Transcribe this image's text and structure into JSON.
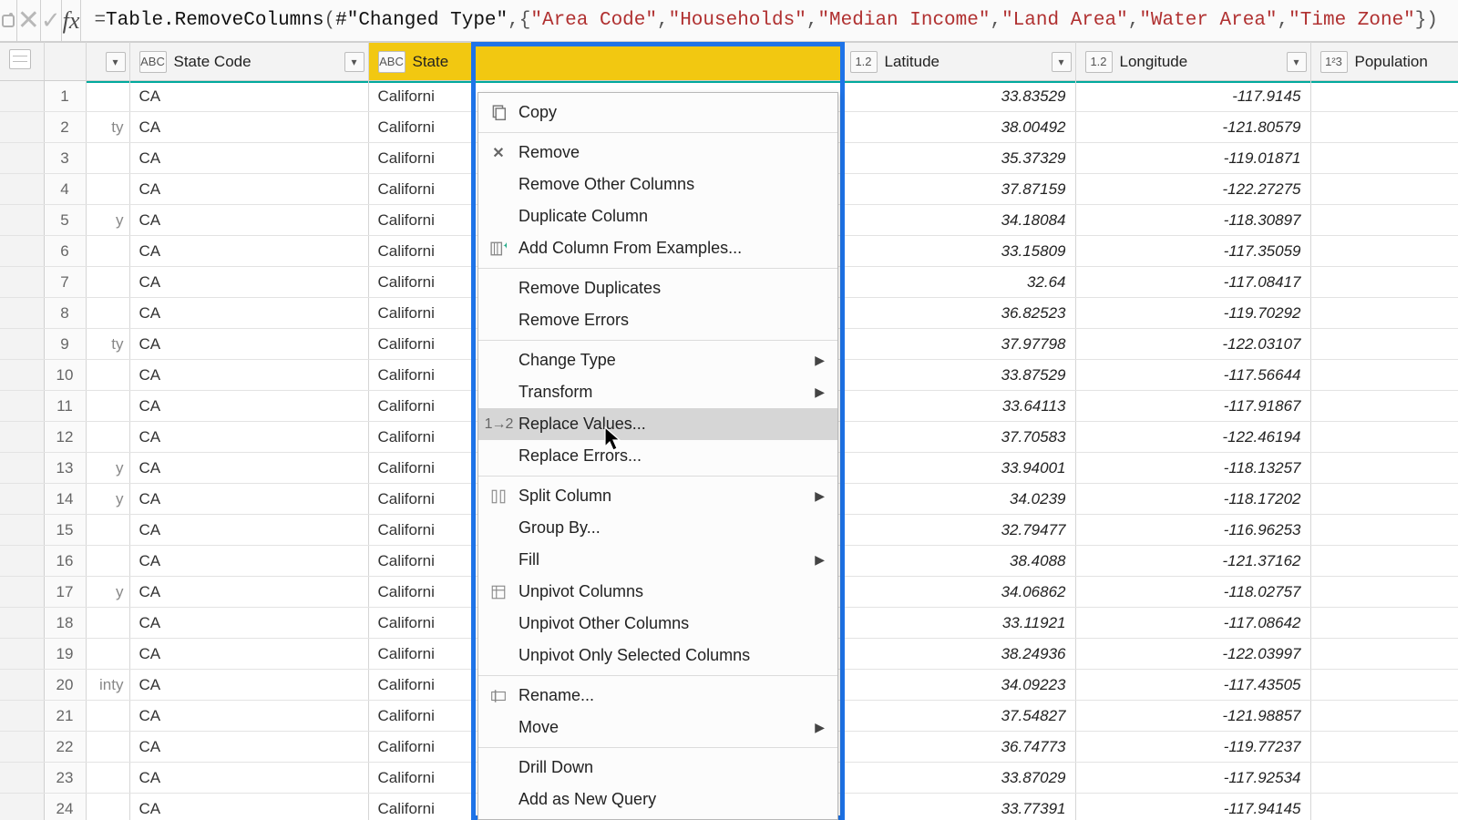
{
  "formula": {
    "prefix": "= ",
    "fn": "Table.RemoveColumns",
    "open": "(",
    "ref": "#\"Changed Type\"",
    "comma": ",",
    "lbrace": "{",
    "cols": [
      "\"Area Code\"",
      "\"Households\"",
      "\"Median Income\"",
      "\"Land Area\"",
      "\"Water Area\"",
      "\"Time Zone\""
    ],
    "sep": ", ",
    "rbrace": "}",
    "close": ")"
  },
  "toolbar": {
    "cancel_glyph": "✕",
    "confirm_glyph": "✓",
    "fx_label": "fx"
  },
  "columns": {
    "state_code": {
      "label": "State Code",
      "type_label": "ABC"
    },
    "state": {
      "label": "State",
      "type_label": "ABC"
    },
    "latitude": {
      "label": "Latitude",
      "type_label": "1.2"
    },
    "longitude": {
      "label": "Longitude",
      "type_label": "1.2"
    },
    "population": {
      "label": "Population",
      "type_label": "1²3"
    }
  },
  "menu": {
    "copy": "Copy",
    "remove": "Remove",
    "remove_other": "Remove Other Columns",
    "duplicate": "Duplicate Column",
    "add_from_examples": "Add Column From Examples...",
    "remove_duplicates": "Remove Duplicates",
    "remove_errors": "Remove Errors",
    "change_type": "Change Type",
    "transform": "Transform",
    "replace_values": "Replace Values...",
    "replace_errors": "Replace Errors...",
    "split_column": "Split Column",
    "group_by": "Group By...",
    "fill": "Fill",
    "unpivot": "Unpivot Columns",
    "unpivot_other": "Unpivot Other Columns",
    "unpivot_selected": "Unpivot Only Selected Columns",
    "rename": "Rename...",
    "move": "Move",
    "drill_down": "Drill Down",
    "add_new_query": "Add as New Query",
    "icon_replace": "1→2"
  },
  "rows": [
    {
      "n": "1",
      "frag": "",
      "sc": "CA",
      "st": "Californi",
      "lat": "33.83529",
      "lon": "-117.9145"
    },
    {
      "n": "2",
      "frag": "ty",
      "sc": "CA",
      "st": "Californi",
      "lat": "38.00492",
      "lon": "-121.80579"
    },
    {
      "n": "3",
      "frag": "",
      "sc": "CA",
      "st": "Californi",
      "lat": "35.37329",
      "lon": "-119.01871"
    },
    {
      "n": "4",
      "frag": "",
      "sc": "CA",
      "st": "Californi",
      "lat": "37.87159",
      "lon": "-122.27275"
    },
    {
      "n": "5",
      "frag": "y",
      "sc": "CA",
      "st": "Californi",
      "lat": "34.18084",
      "lon": "-118.30897"
    },
    {
      "n": "6",
      "frag": "",
      "sc": "CA",
      "st": "Californi",
      "lat": "33.15809",
      "lon": "-117.35059"
    },
    {
      "n": "7",
      "frag": "",
      "sc": "CA",
      "st": "Californi",
      "lat": "32.64",
      "lon": "-117.08417"
    },
    {
      "n": "8",
      "frag": "",
      "sc": "CA",
      "st": "Californi",
      "lat": "36.82523",
      "lon": "-119.70292"
    },
    {
      "n": "9",
      "frag": "ty",
      "sc": "CA",
      "st": "Californi",
      "lat": "37.97798",
      "lon": "-122.03107"
    },
    {
      "n": "10",
      "frag": "",
      "sc": "CA",
      "st": "Californi",
      "lat": "33.87529",
      "lon": "-117.56644"
    },
    {
      "n": "11",
      "frag": "",
      "sc": "CA",
      "st": "Californi",
      "lat": "33.64113",
      "lon": "-117.91867"
    },
    {
      "n": "12",
      "frag": "",
      "sc": "CA",
      "st": "Californi",
      "lat": "37.70583",
      "lon": "-122.46194"
    },
    {
      "n": "13",
      "frag": "y",
      "sc": "CA",
      "st": "Californi",
      "lat": "33.94001",
      "lon": "-118.13257"
    },
    {
      "n": "14",
      "frag": "y",
      "sc": "CA",
      "st": "Californi",
      "lat": "34.0239",
      "lon": "-118.17202"
    },
    {
      "n": "15",
      "frag": "",
      "sc": "CA",
      "st": "Californi",
      "lat": "32.79477",
      "lon": "-116.96253"
    },
    {
      "n": "16",
      "frag": "",
      "sc": "CA",
      "st": "Californi",
      "lat": "38.4088",
      "lon": "-121.37162"
    },
    {
      "n": "17",
      "frag": "y",
      "sc": "CA",
      "st": "Californi",
      "lat": "34.06862",
      "lon": "-118.02757"
    },
    {
      "n": "18",
      "frag": "",
      "sc": "CA",
      "st": "Californi",
      "lat": "33.11921",
      "lon": "-117.08642"
    },
    {
      "n": "19",
      "frag": "",
      "sc": "CA",
      "st": "Californi",
      "lat": "38.24936",
      "lon": "-122.03997"
    },
    {
      "n": "20",
      "frag": "inty",
      "sc": "CA",
      "st": "Californi",
      "lat": "34.09223",
      "lon": "-117.43505"
    },
    {
      "n": "21",
      "frag": "",
      "sc": "CA",
      "st": "Californi",
      "lat": "37.54827",
      "lon": "-121.98857"
    },
    {
      "n": "22",
      "frag": "",
      "sc": "CA",
      "st": "Californi",
      "lat": "36.74773",
      "lon": "-119.77237"
    },
    {
      "n": "23",
      "frag": "",
      "sc": "CA",
      "st": "Californi",
      "lat": "33.87029",
      "lon": "-117.92534"
    },
    {
      "n": "24",
      "frag": "",
      "sc": "CA",
      "st": "Californi",
      "lat": "33.77391",
      "lon": "-117.94145"
    }
  ]
}
